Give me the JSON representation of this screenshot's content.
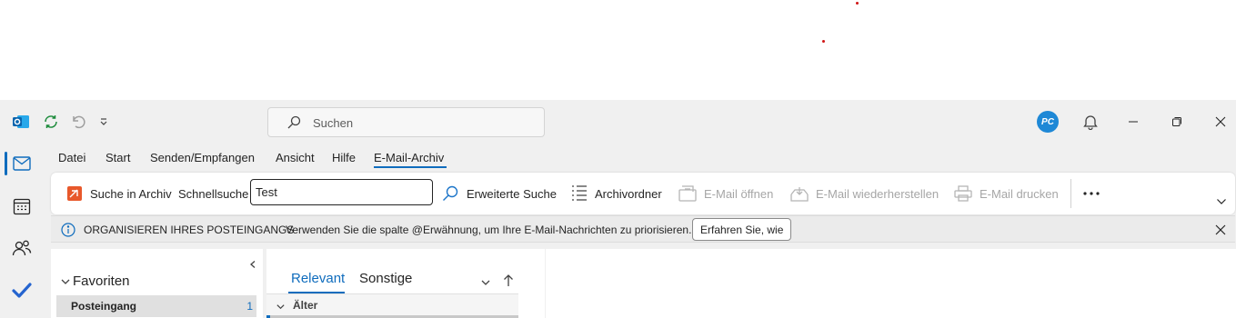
{
  "titlebar": {
    "search_placeholder": "Suchen",
    "avatar_initials": "PC",
    "accent_color": "#0f6cbd"
  },
  "menu": {
    "tabs": [
      {
        "label": "Datei"
      },
      {
        "label": "Start"
      },
      {
        "label": "Senden/Empfangen"
      },
      {
        "label": "Ansicht"
      },
      {
        "label": "Hilfe"
      },
      {
        "label": "E-Mail-Archiv",
        "active": true
      }
    ]
  },
  "ribbon": {
    "search_in_archive": "Suche in Archiv",
    "quick_search_label": "Schnellsuche",
    "quick_search_value": "Test",
    "advanced_search": "Erweiterte Suche",
    "archive_folder": "Archivordner",
    "open_email": "E-Mail öffnen",
    "restore_email": "E-Mail wiederherstellen",
    "print_email": "E-Mail drucken"
  },
  "infobar": {
    "title": "ORGANISIEREN IHRES POSTEINGANGS",
    "message": "Verwenden Sie die spalte @Erwähnung, um Ihre E-Mail-Nachrichten zu priorisieren.",
    "learn_button": "Erfahren Sie, wie"
  },
  "folders": {
    "favorites_label": "Favoriten",
    "inbox_label": "Posteingang",
    "inbox_count": "1"
  },
  "list": {
    "tab_relevant": "Relevant",
    "tab_other": "Sonstige",
    "group_label": "Älter"
  }
}
